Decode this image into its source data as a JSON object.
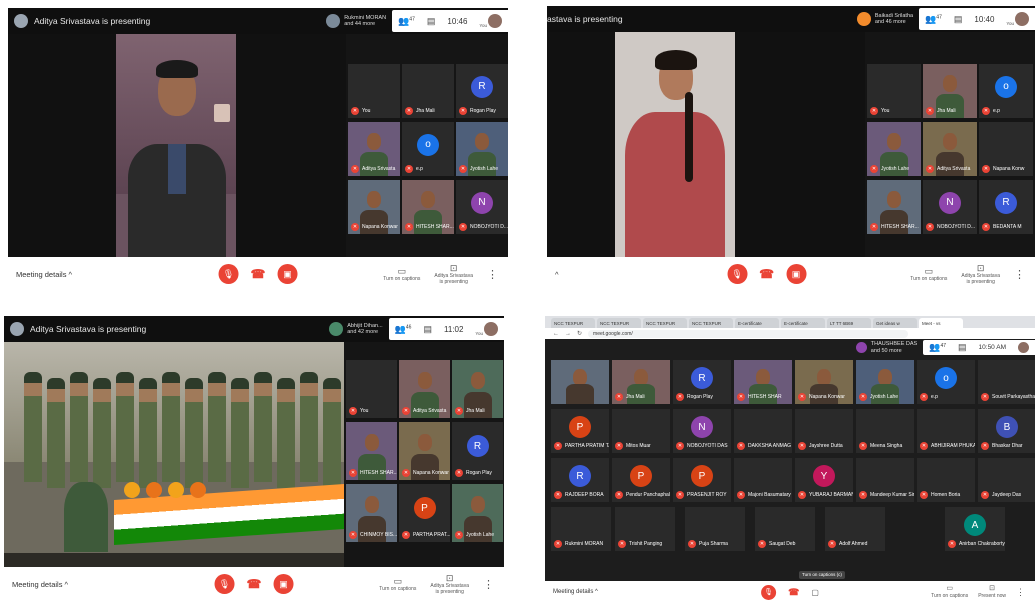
{
  "colors": {
    "accent_red": "#ea4335",
    "meet_dark": "#1d1d1d",
    "topbar_dark": "#0f0f0f"
  },
  "icons": {
    "mic_off": "mic-off-icon",
    "cam_off": "camera-off-icon",
    "hangup": "phone-hangup-icon",
    "people": "people-icon",
    "chat": "chat-icon",
    "captions": "captions-icon",
    "present": "present-screen-icon",
    "more": "more-vert-icon",
    "chevron": "chevron-up-icon"
  },
  "q1": {
    "presenting": "Aditya Srivastava is presenting",
    "presenter_name": "Rukmini MORAN",
    "presenter_more": "and 44 more",
    "people_count": "47",
    "time": "10:46",
    "you_label": "You",
    "meeting_details": "Meeting details",
    "turn_on_captions": "Turn on captions",
    "present_name": "Aditya Srivastava",
    "is_presenting": "is presenting",
    "tiles": [
      {
        "name": "You",
        "avatar": ""
      },
      {
        "name": "Jha Mali",
        "avatar": ""
      },
      {
        "name": "Rogan Play",
        "avatar": "R"
      },
      {
        "name": "Aditya Srivasta",
        "avatar": ""
      },
      {
        "name": "e.p",
        "avatar": "o"
      },
      {
        "name": "Jyotish Lahe",
        "avatar": ""
      },
      {
        "name": "Napana Konwar",
        "avatar": ""
      },
      {
        "name": "HITESH SHAR...",
        "avatar": ""
      },
      {
        "name": "NOBOJYOTI D...",
        "avatar": "N"
      }
    ]
  },
  "q2": {
    "presenting": "astava is presenting",
    "presenter_name": "Baikadi Srilatha",
    "presenter_more": "and 46 more",
    "people_count": "47",
    "time": "10:40",
    "you_label": "You",
    "turn_on_captions": "Turn on captions",
    "present_name": "Aditya Srivastava",
    "is_presenting": "is presenting",
    "tiles": [
      {
        "name": "You",
        "avatar": ""
      },
      {
        "name": "Jha Mali",
        "avatar": ""
      },
      {
        "name": "e.p",
        "avatar": "o"
      },
      {
        "name": "Jyotish Lahe",
        "avatar": ""
      },
      {
        "name": "Aditya Srivasta",
        "avatar": ""
      },
      {
        "name": "Napana Konw",
        "avatar": ""
      },
      {
        "name": "HITESH SHAR...",
        "avatar": ""
      },
      {
        "name": "NOBOJYOTI D...",
        "avatar": "N"
      },
      {
        "name": "BEDANTA M",
        "avatar": "R"
      }
    ]
  },
  "q3": {
    "presenting": "Aditya Srivastava is presenting",
    "presenter_name": "Abhijit Dihan...",
    "presenter_more": "and 42 more",
    "people_count": "46",
    "time": "11:02",
    "you_label": "You",
    "meeting_details": "Meeting details",
    "turn_on_captions": "Turn on captions",
    "present_name": "Aditya Srivastava",
    "is_presenting": "is presenting",
    "tiles": [
      {
        "name": "You",
        "avatar": ""
      },
      {
        "name": "Aditya Srivasta",
        "avatar": ""
      },
      {
        "name": "Jha Mali",
        "avatar": ""
      },
      {
        "name": "HITESH SHAR...",
        "avatar": ""
      },
      {
        "name": "Napana Konwar",
        "avatar": ""
      },
      {
        "name": "Rogan Play",
        "avatar": "R"
      },
      {
        "name": "CHINMOY BIS...",
        "avatar": ""
      },
      {
        "name": "PARTHA PRAT...",
        "avatar": "P"
      },
      {
        "name": "Jyotish Lahe",
        "avatar": ""
      }
    ]
  },
  "q4": {
    "tabs": [
      "NCC TEXPUR",
      "NCC TEXPUR",
      "NCC TEXPUR",
      "NCC TEXPUR",
      "E-certificate",
      "E-certificate",
      "LT TT 6B69",
      "Get ideas w",
      "Meet - vs"
    ],
    "url": "meet.google.com/",
    "presenter_name": "THAUSHBEE DAS",
    "presenter_more": "and 50 more",
    "people_count": "47",
    "time": "10:50 AM",
    "meeting_details": "Meeting details",
    "turn_on_captions": "Turn on captions",
    "present_now": "Present now",
    "tooltip": "Turn on captions (c)",
    "rows": [
      [
        {
          "name": "",
          "avatar": ""
        },
        {
          "name": "Jha Mali",
          "avatar": ""
        },
        {
          "name": "Rogan Play",
          "avatar": "R"
        },
        {
          "name": "HITESH SHAR",
          "avatar": ""
        },
        {
          "name": "Napana Konwar",
          "avatar": ""
        },
        {
          "name": "Jyotish Lahe",
          "avatar": ""
        },
        {
          "name": "e.p",
          "avatar": "o"
        },
        {
          "name": "Souvit Parkayastha",
          "avatar": ""
        }
      ],
      [
        {
          "name": "PARTHA PRATIM TA",
          "avatar": "P"
        },
        {
          "name": "Mitos Muar",
          "avatar": ""
        },
        {
          "name": "NOBOJYOTI DAS",
          "avatar": "N"
        },
        {
          "name": "DAKKSHA ANMAG",
          "avatar": ""
        },
        {
          "name": "Jayshree Dutta",
          "avatar": ""
        },
        {
          "name": "Meena Singha",
          "avatar": ""
        },
        {
          "name": "ABHIJIRAM PHUKAN",
          "avatar": ""
        },
        {
          "name": "Bhaskar Dhar",
          "avatar": "B"
        }
      ],
      [
        {
          "name": "RAJDEEP BORA",
          "avatar": "R"
        },
        {
          "name": "Pendur Panchaphala",
          "avatar": "P"
        },
        {
          "name": "PRASENJIT ROY",
          "avatar": "P"
        },
        {
          "name": "Majoni Basumatary",
          "avatar": ""
        },
        {
          "name": "YUBARAJ BARMAN",
          "avatar": "Y"
        },
        {
          "name": "Mandeep Kumar Sin...",
          "avatar": ""
        },
        {
          "name": "Homen Boria",
          "avatar": ""
        },
        {
          "name": "Jaydeep Das",
          "avatar": ""
        }
      ],
      [
        {
          "name": "Rukmini MORAN",
          "avatar": ""
        },
        {
          "name": "Trishit Panging",
          "avatar": ""
        },
        {
          "name": "Puja Sharma",
          "avatar": ""
        },
        {
          "name": "Saugat Deb",
          "avatar": ""
        },
        {
          "name": "Adolf Ahmed",
          "avatar": ""
        },
        {
          "name": "Anirban Chakraborty",
          "avatar": "A"
        }
      ]
    ]
  }
}
